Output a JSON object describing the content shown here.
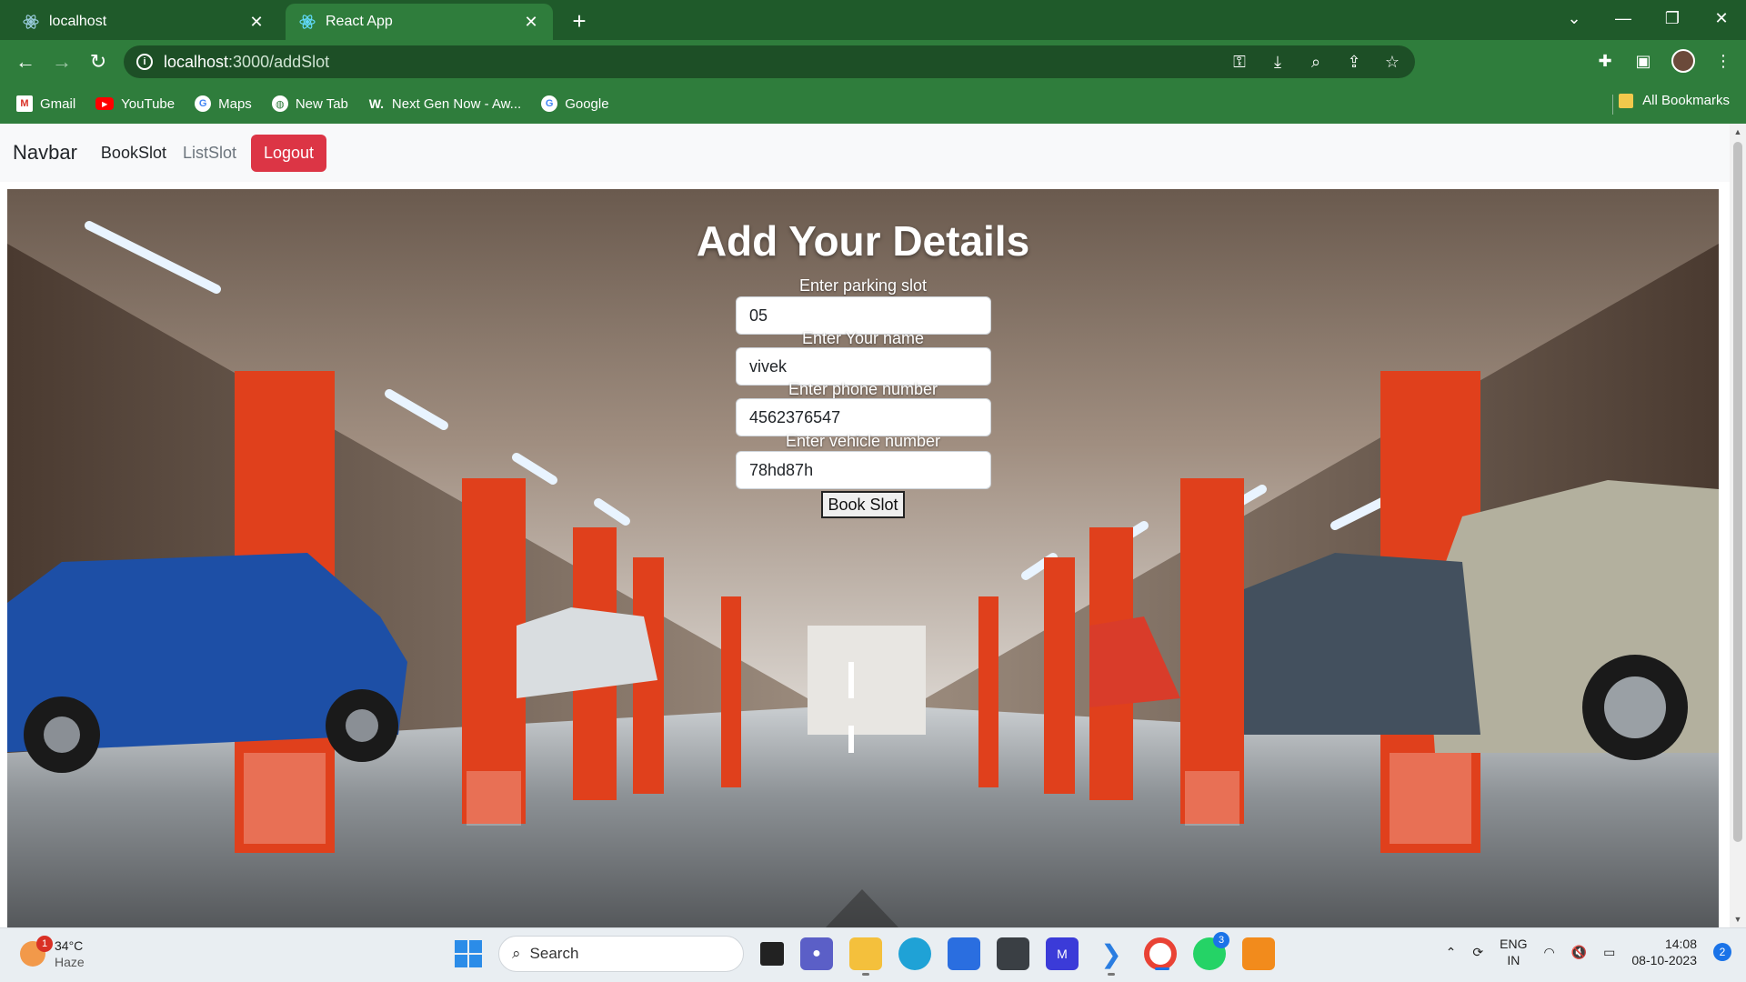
{
  "browser": {
    "tabs": [
      {
        "title": "localhost",
        "active": false
      },
      {
        "title": "React App",
        "active": true
      }
    ],
    "new_tab_icon": "plus-icon",
    "address": {
      "host": "localhost",
      "path": ":3000/addSlot"
    },
    "bookmarks": [
      {
        "label": "Gmail",
        "icon": "gmail-icon"
      },
      {
        "label": "YouTube",
        "icon": "youtube-icon"
      },
      {
        "label": "Maps",
        "icon": "google-icon"
      },
      {
        "label": "New Tab",
        "icon": "globe-icon"
      },
      {
        "label": "Next Gen Now - Aw...",
        "icon": "w-icon"
      },
      {
        "label": "Google",
        "icon": "google-icon"
      }
    ],
    "all_bookmarks": "All Bookmarks",
    "theme_color": "#2f7d3c"
  },
  "navbar": {
    "brand": "Navbar",
    "links": [
      "BookSlot",
      "ListSlot"
    ],
    "logout": "Logout",
    "logout_color": "#dc3545"
  },
  "form": {
    "title": "Add Your Details",
    "fields": [
      {
        "label": "Enter parking slot",
        "value": "05"
      },
      {
        "label": "Enter Your name",
        "value": "vivek"
      },
      {
        "label": "Enter phone number",
        "value": "4562376547"
      },
      {
        "label": "Enter vehicle number",
        "value": "78hd87h"
      }
    ],
    "submit": "Book Slot"
  },
  "taskbar": {
    "weather": {
      "temp": "34°C",
      "condition": "Haze",
      "badge": "1"
    },
    "search_placeholder": "Search",
    "whatsapp_badge": "3",
    "lang": {
      "top": "ENG",
      "bottom": "IN"
    },
    "time": "14:08",
    "date": "08-10-2023",
    "notifications": "2"
  }
}
